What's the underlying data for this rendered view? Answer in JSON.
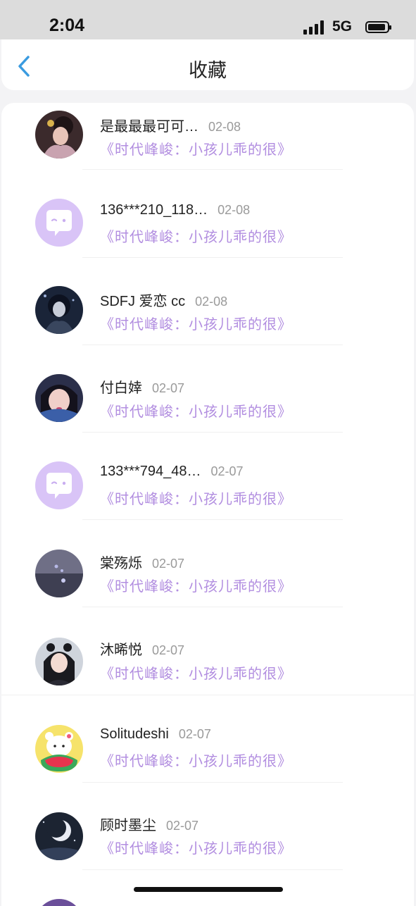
{
  "status": {
    "time": "2:04",
    "network": "5G"
  },
  "header": {
    "title": "收藏",
    "back_icon": "chevron-left-icon",
    "accent": "#3a9be0"
  },
  "colors": {
    "title_accent": "#b28ee0",
    "date": "#9a9a9a"
  },
  "items": [
    {
      "name": "是最最最可可…",
      "date": "02-08",
      "title": "《时代峰峻：小孩儿乖的很》",
      "avatar": "photo-avatar"
    },
    {
      "name": "136***210_118…",
      "date": "02-08",
      "title": "《时代峰峻：小孩儿乖的很》",
      "avatar": "default-chat-avatar"
    },
    {
      "name": "SDFJ 爱恋 cc",
      "date": "02-08",
      "title": "《时代峰峻：小孩儿乖的很》",
      "avatar": "photo-avatar"
    },
    {
      "name": "付白婞",
      "date": "02-07",
      "title": "《时代峰峻：小孩儿乖的很》",
      "avatar": "photo-avatar"
    },
    {
      "name": "133***794_48…",
      "date": "02-07",
      "title": "《时代峰峻：小孩儿乖的很》",
      "avatar": "default-chat-avatar"
    },
    {
      "name": "棠殇烁",
      "date": "02-07",
      "title": "《时代峰峻：小孩儿乖的很》",
      "avatar": "photo-avatar"
    },
    {
      "name": "沐晞悦",
      "date": "02-07",
      "title": "《时代峰峻：小孩儿乖的很》",
      "avatar": "photo-avatar"
    },
    {
      "name": "Solitudeshi",
      "date": "02-07",
      "title": "《时代峰峻：小孩儿乖的很》",
      "avatar": "cartoon-avatar"
    },
    {
      "name": "顾时墨尘",
      "date": "02-07",
      "title": "《时代峰峻：小孩儿乖的很》",
      "avatar": "moon-avatar"
    }
  ]
}
